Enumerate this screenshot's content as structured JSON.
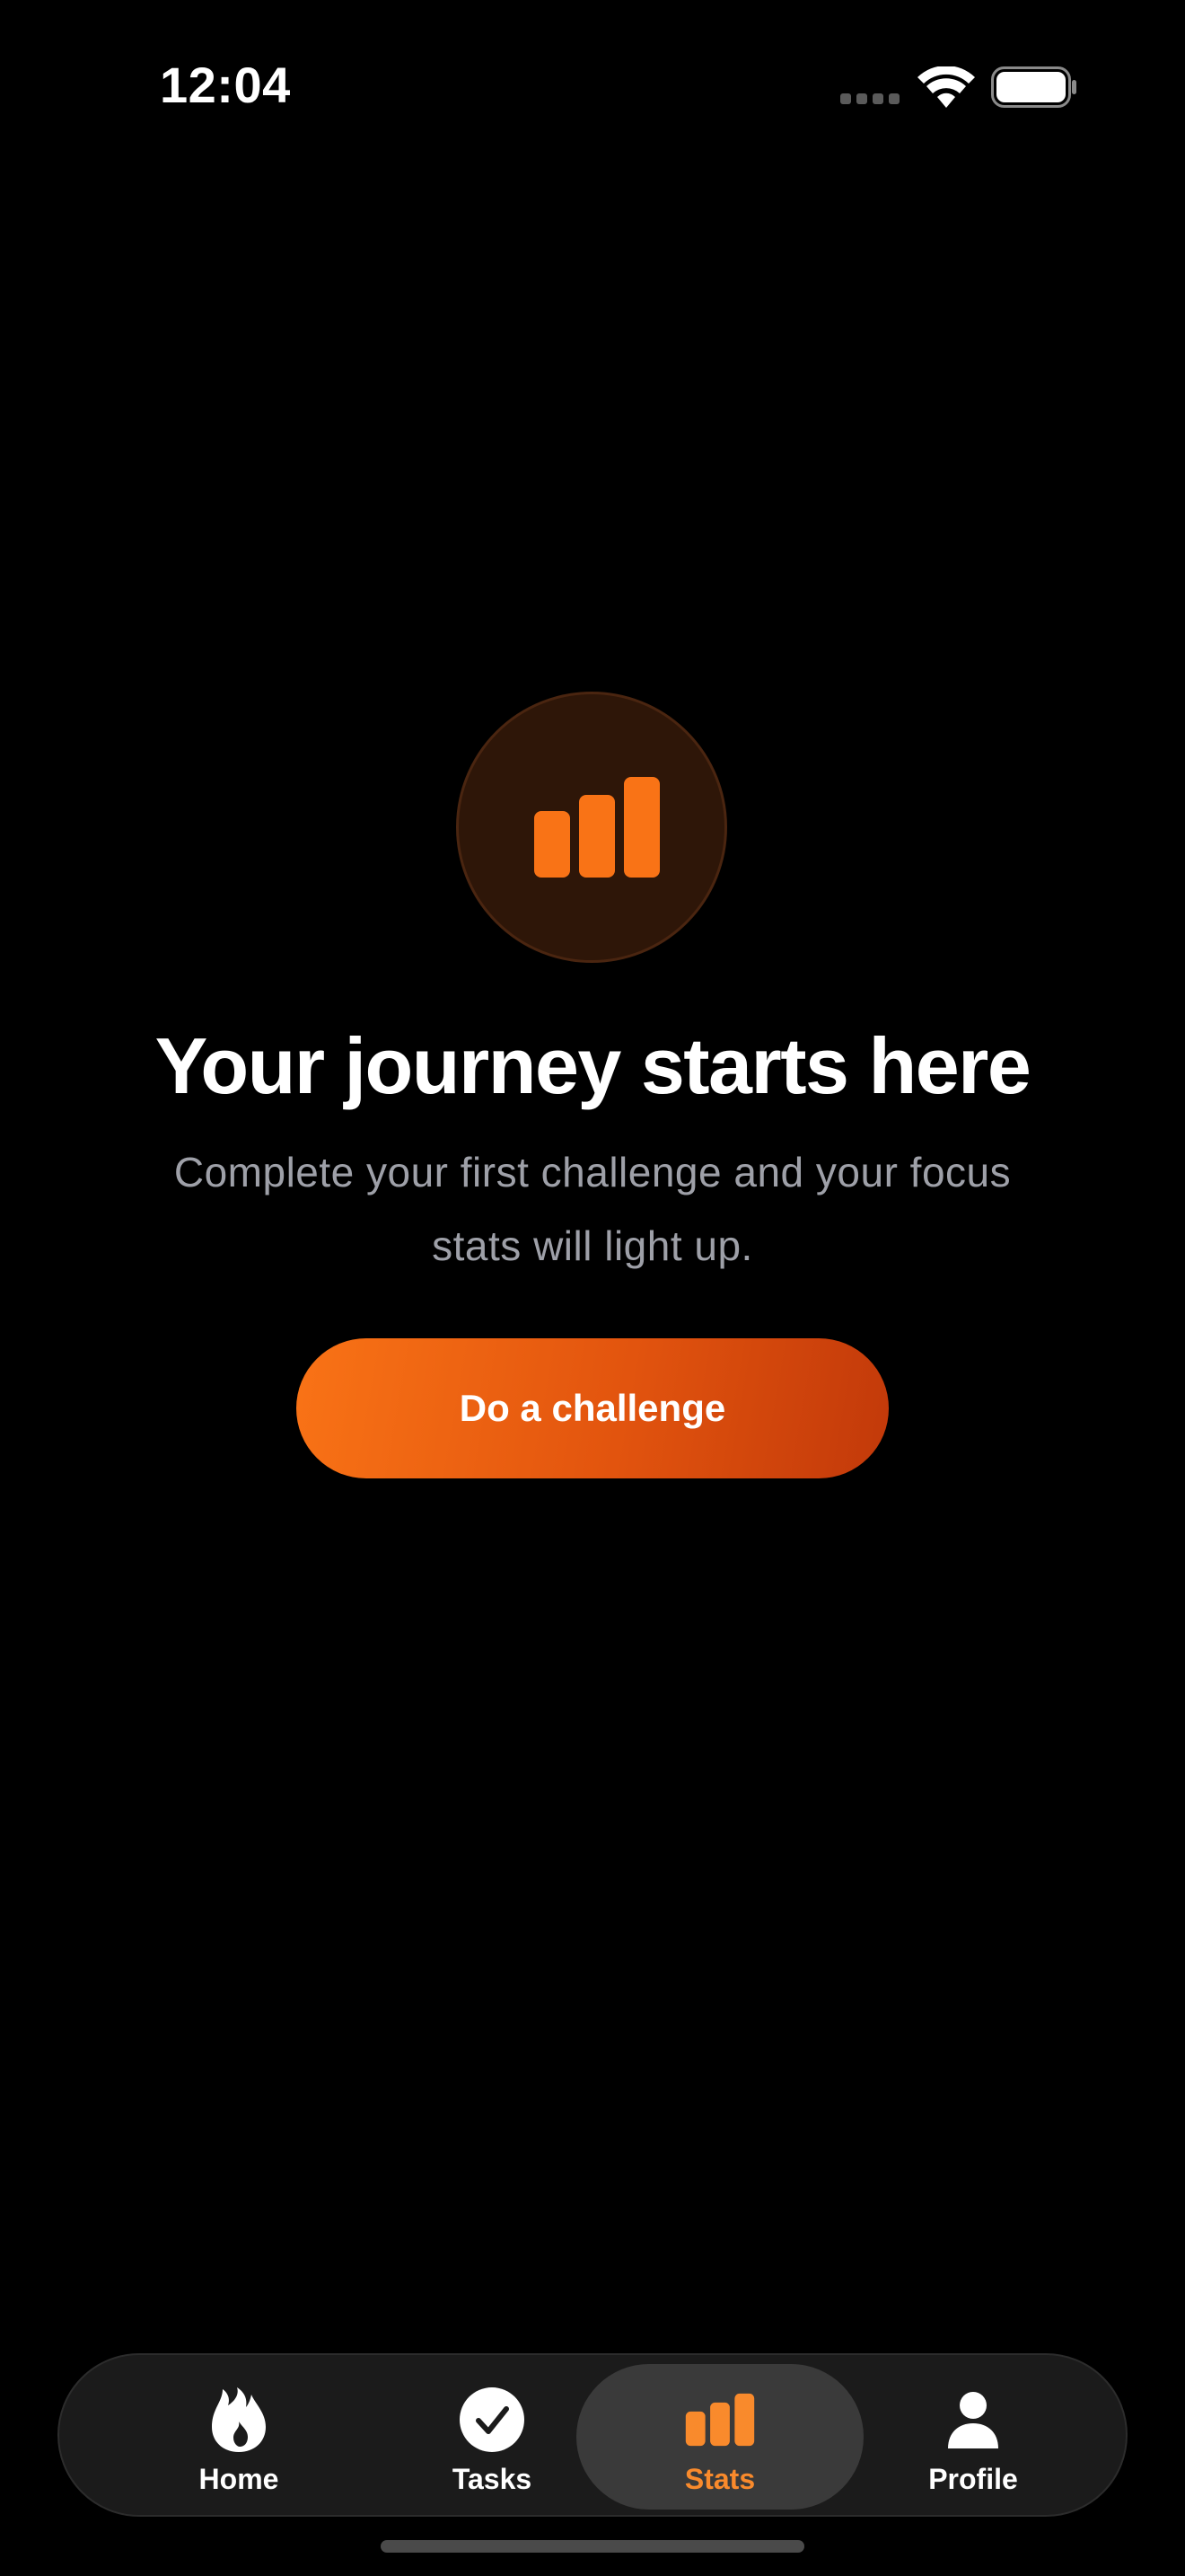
{
  "status_bar": {
    "time": "12:04"
  },
  "hero": {
    "title": "Your journey starts here",
    "subtitle": "Complete your first challenge and your focus stats will light up.",
    "icon": "bar-chart-icon"
  },
  "cta": {
    "label": "Do a challenge"
  },
  "tabs": [
    {
      "label": "Home",
      "icon": "flame-icon",
      "active": false
    },
    {
      "label": "Tasks",
      "icon": "check-circle-icon",
      "active": false
    },
    {
      "label": "Stats",
      "icon": "bar-chart-icon",
      "active": true
    },
    {
      "label": "Profile",
      "icon": "person-icon",
      "active": false
    }
  ],
  "colors": {
    "accent": "#f97316",
    "accent_dark": "#c2390a",
    "background": "#000000",
    "subtitle": "#9ea0a8",
    "tab_active_label": "#f98a2c"
  }
}
